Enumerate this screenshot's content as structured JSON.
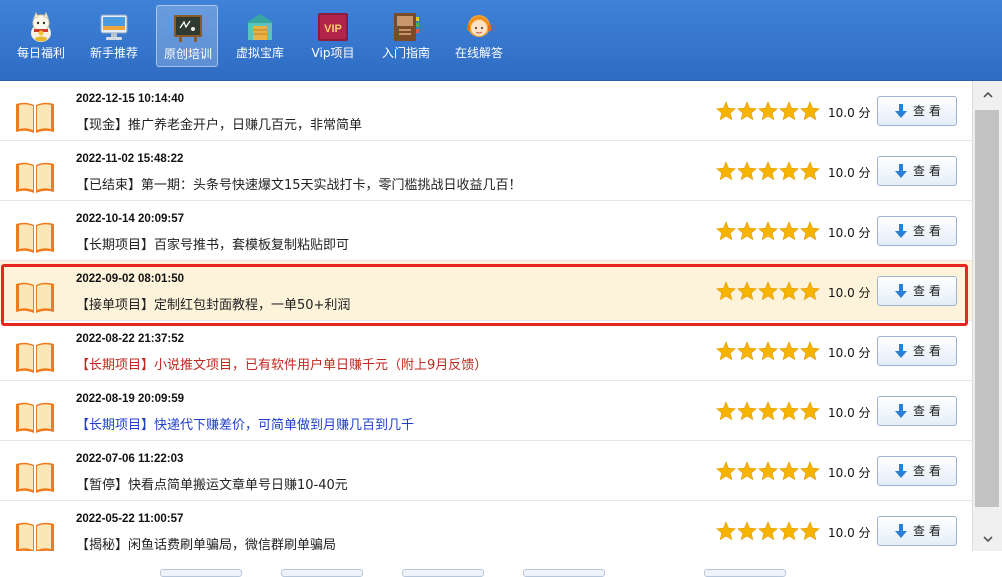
{
  "toolbar": {
    "items": [
      {
        "label": "每日福利",
        "icon": "lucky-cat-icon",
        "active": false
      },
      {
        "label": "新手推荐",
        "icon": "monitor-icon",
        "active": false
      },
      {
        "label": "原创培训",
        "icon": "blackboard-icon",
        "active": true
      },
      {
        "label": "虚拟宝库",
        "icon": "warehouse-icon",
        "active": false
      },
      {
        "label": "Vip项目",
        "icon": "vip-icon",
        "active": false
      },
      {
        "label": "入门指南",
        "icon": "guide-book-icon",
        "active": false
      },
      {
        "label": "在线解答",
        "icon": "support-agent-icon",
        "active": false
      }
    ],
    "vip_badge": "VIP"
  },
  "list": {
    "rows": [
      {
        "date": "2022-12-15 10:14:40",
        "title": "【现金】推广养老金开户，日赚几百元，非常简单",
        "score": "10.0 分",
        "button": "查 看",
        "rating": 5,
        "color": "#222222"
      },
      {
        "date": "2022-11-02 15:48:22",
        "title": "【已结束】第一期：头条号快速爆文15天实战打卡，零门槛挑战日收益几百！",
        "score": "10.0 分",
        "button": "查 看",
        "rating": 5,
        "color": "#222222"
      },
      {
        "date": "2022-10-14 20:09:57",
        "title": "【长期项目】百家号推书，套模板复制粘贴即可",
        "score": "10.0 分",
        "button": "查 看",
        "rating": 5,
        "color": "#222222"
      },
      {
        "date": "2022-09-02 08:01:50",
        "title": "【接单项目】定制红包封面教程，一单50+利润",
        "score": "10.0 分",
        "button": "查 看",
        "rating": 5,
        "color": "#222222",
        "highlighted": true
      },
      {
        "date": "2022-08-22 21:37:52",
        "title": "【长期项目】小说推文项目，已有软件用户单日赚千元（附上9月反馈）",
        "score": "10.0 分",
        "button": "查 看",
        "rating": 5,
        "color": "#c0281f"
      },
      {
        "date": "2022-08-19 20:09:59",
        "title": "【长期项目】快递代下赚差价，可简单做到月赚几百到几千",
        "score": "10.0 分",
        "button": "查 看",
        "rating": 5,
        "color": "#1f3fc9"
      },
      {
        "date": "2022-07-06 11:22:03",
        "title": "【暂停】快看点简单搬运文章单号日赚10-40元",
        "score": "10.0 分",
        "button": "查 看",
        "rating": 5,
        "color": "#222222"
      },
      {
        "date": "2022-05-22 11:00:57",
        "title": "【揭秘】闲鱼话费刷单骗局，微信群刷单骗局",
        "score": "10.0 分",
        "button": "查 看",
        "rating": 5,
        "color": "#222222"
      }
    ]
  },
  "colors": {
    "toolbar_blue": "#3f82d8",
    "highlight_bg": "#fdf3da",
    "highlight_border": "#e8251f",
    "star_gold": "#f6b400",
    "book_orange": "#f07a1c"
  }
}
